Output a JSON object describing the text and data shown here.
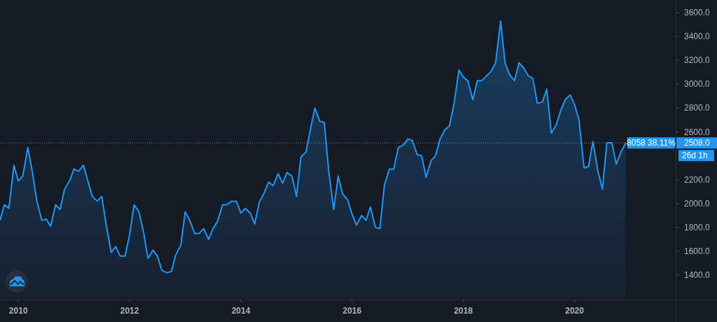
{
  "chart": {
    "chart_data": {
      "type": "area",
      "x": [
        2009.67,
        2009.75,
        2009.83,
        2009.92,
        2010.0,
        2010.08,
        2010.17,
        2010.25,
        2010.33,
        2010.42,
        2010.5,
        2010.58,
        2010.67,
        2010.75,
        2010.83,
        2010.92,
        2011.0,
        2011.08,
        2011.17,
        2011.25,
        2011.33,
        2011.42,
        2011.5,
        2011.58,
        2011.67,
        2011.75,
        2011.83,
        2011.92,
        2012.0,
        2012.08,
        2012.17,
        2012.25,
        2012.33,
        2012.42,
        2012.5,
        2012.58,
        2012.67,
        2012.75,
        2012.83,
        2012.92,
        2013.0,
        2013.08,
        2013.17,
        2013.25,
        2013.33,
        2013.42,
        2013.5,
        2013.58,
        2013.67,
        2013.75,
        2013.83,
        2013.92,
        2014.0,
        2014.08,
        2014.17,
        2014.25,
        2014.33,
        2014.42,
        2014.5,
        2014.58,
        2014.67,
        2014.75,
        2014.83,
        2014.92,
        2015.0,
        2015.08,
        2015.17,
        2015.25,
        2015.33,
        2015.42,
        2015.5,
        2015.58,
        2015.67,
        2015.75,
        2015.83,
        2015.92,
        2016.0,
        2016.08,
        2016.17,
        2016.25,
        2016.33,
        2016.42,
        2016.5,
        2016.58,
        2016.67,
        2016.75,
        2016.83,
        2016.92,
        2017.0,
        2017.08,
        2017.17,
        2017.25,
        2017.33,
        2017.42,
        2017.5,
        2017.58,
        2017.67,
        2017.75,
        2017.83,
        2017.92,
        2018.0,
        2018.08,
        2018.17,
        2018.25,
        2018.33,
        2018.42,
        2018.5,
        2018.58,
        2018.67,
        2018.75,
        2018.83,
        2018.92,
        2019.0,
        2019.08,
        2019.17,
        2019.25,
        2019.33,
        2019.42,
        2019.5,
        2019.58,
        2019.67,
        2019.75,
        2019.83,
        2019.92,
        2020.0,
        2020.08,
        2020.17,
        2020.25,
        2020.33,
        2020.42,
        2020.5,
        2020.58,
        2020.67,
        2020.75,
        2020.83,
        2020.92
      ],
      "series": [
        {
          "color": "#2196f3",
          "values": [
            1860,
            1990,
            1960,
            2320,
            2190,
            2230,
            2470,
            2270,
            2030,
            1860,
            1870,
            1810,
            1990,
            1950,
            2120,
            2190,
            2290,
            2270,
            2320,
            2190,
            2060,
            2020,
            2060,
            1820,
            1590,
            1640,
            1560,
            1560,
            1740,
            1990,
            1930,
            1760,
            1540,
            1610,
            1560,
            1440,
            1420,
            1430,
            1570,
            1650,
            1930,
            1860,
            1750,
            1750,
            1790,
            1700,
            1790,
            1850,
            1990,
            1990,
            2020,
            2020,
            1920,
            1960,
            1920,
            1830,
            2010,
            2090,
            2180,
            2150,
            2250,
            2170,
            2260,
            2230,
            2060,
            2390,
            2430,
            2620,
            2800,
            2690,
            2680,
            2270,
            1950,
            2230,
            2080,
            2030,
            1910,
            1820,
            1900,
            1860,
            1970,
            1800,
            1790,
            2150,
            2290,
            2290,
            2470,
            2490,
            2540,
            2530,
            2410,
            2400,
            2220,
            2360,
            2400,
            2540,
            2620,
            2650,
            2830,
            3120,
            3060,
            3030,
            2870,
            3030,
            3030,
            3070,
            3110,
            3180,
            3530,
            3180,
            3080,
            3030,
            3180,
            3140,
            3070,
            3050,
            2840,
            2850,
            2960,
            2590,
            2660,
            2780,
            2870,
            2910,
            2830,
            2700,
            2300,
            2310,
            2520,
            2270,
            2120,
            2510,
            2510,
            2330,
            2430,
            2508
          ]
        }
      ],
      "xlim": [
        2009.67,
        2022.56
      ],
      "ylim": [
        1195,
        3706
      ],
      "ref_lines": [
        {
          "axis": "y",
          "value": 2508
        }
      ],
      "xticks": [
        {
          "value": 2010,
          "label": "2010"
        },
        {
          "value": 2012,
          "label": "2012"
        },
        {
          "value": 2014,
          "label": "2014"
        },
        {
          "value": 2016,
          "label": "2016"
        },
        {
          "value": 2018,
          "label": "2018"
        },
        {
          "value": 2020,
          "label": "2020"
        }
      ],
      "yticks": [
        {
          "value": 1400,
          "label": "1400.0"
        },
        {
          "value": 1600,
          "label": "1600.0"
        },
        {
          "value": 1800,
          "label": "1800.0"
        },
        {
          "value": 2000,
          "label": "2000.0"
        },
        {
          "value": 2200,
          "label": "2200.0"
        },
        {
          "value": 2600,
          "label": "2600.0"
        },
        {
          "value": 2800,
          "label": "2800.0"
        },
        {
          "value": 3000,
          "label": "3000.0"
        },
        {
          "value": 3200,
          "label": "3200.0"
        },
        {
          "value": 3400,
          "label": "3400.0"
        },
        {
          "value": 3600,
          "label": "3600.0"
        }
      ]
    },
    "measure_label": "8058 38.11%",
    "price_label": "2508.0",
    "duration_label": "26d 1h"
  }
}
